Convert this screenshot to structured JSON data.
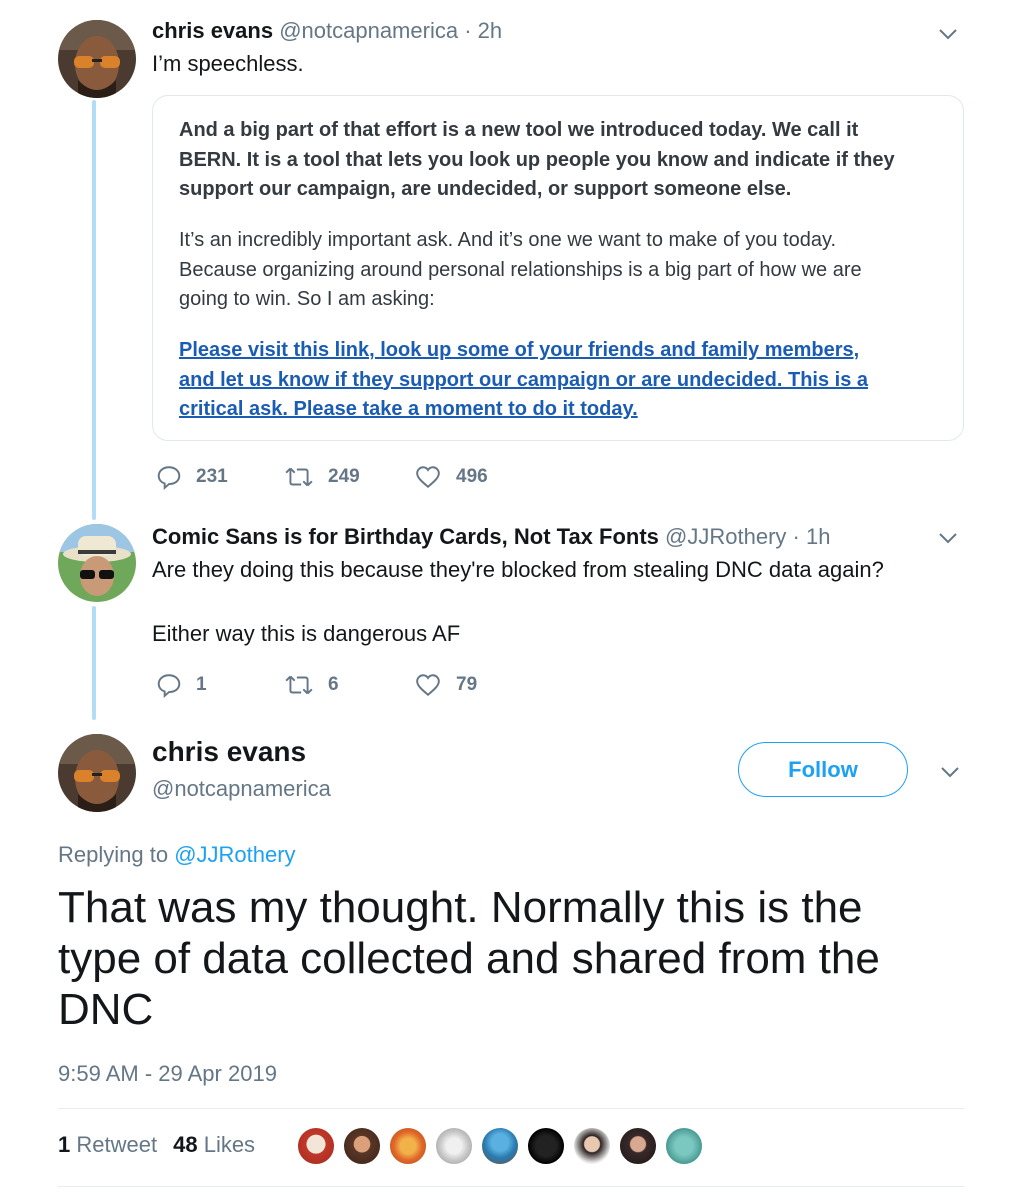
{
  "tweet1": {
    "name": "chris evans",
    "handle": "@notcapnamerica",
    "time": "· 2h",
    "text": "I’m speechless.",
    "quote": {
      "bold_lines": [
        "And a big part of that effort is a new tool we introduced today. We call it",
        "BERN. It is a tool that lets you look up people you know and indicate if they",
        "support our campaign, are undecided, or support someone else."
      ],
      "normal_lines": [
        "It’s an incredibly important ask. And it’s one we want to make of you today.",
        "Because organizing around personal relationships is a big part of how we are",
        "going to win. So I am asking:"
      ],
      "link_lines": [
        "Please visit this link, look up some of your friends and family members,",
        "and let us know if they support our campaign or are undecided. This is a",
        "critical ask. Please take a moment to do it today."
      ]
    },
    "replies": "231",
    "retweets": "249",
    "likes": "496"
  },
  "tweet2": {
    "name": "Comic Sans is for Birthday Cards, Not Tax Fonts",
    "handle": "@JJRothery",
    "time": "· 1h",
    "text_line1": "Are they doing this because they're blocked from stealing DNC data again?",
    "text_line2": "Either way this is dangerous AF",
    "replies": "1",
    "retweets": "6",
    "likes": "79"
  },
  "main_tweet": {
    "name": "chris evans",
    "handle": "@notcapnamerica",
    "follow_label": "Follow",
    "replying_prefix": "Replying to ",
    "replying_mention": "@JJRothery",
    "text_lines": [
      "That was my thought.  Normally this is the",
      "type of data collected and shared from the",
      "DNC"
    ],
    "timestamp": "9:59 AM - 29 Apr 2019",
    "retweet_count": "1",
    "retweet_label": "Retweet",
    "like_count": "48",
    "like_label": "Likes"
  },
  "icons": {
    "reply": "reply-icon",
    "retweet": "retweet-icon",
    "like": "heart-icon",
    "caret": "chevron-down-icon"
  },
  "colors": {
    "accent": "#1da1f2",
    "thread_line": "#b3dcf7",
    "secondary_text": "#657786",
    "link": "#1a5cb3"
  }
}
